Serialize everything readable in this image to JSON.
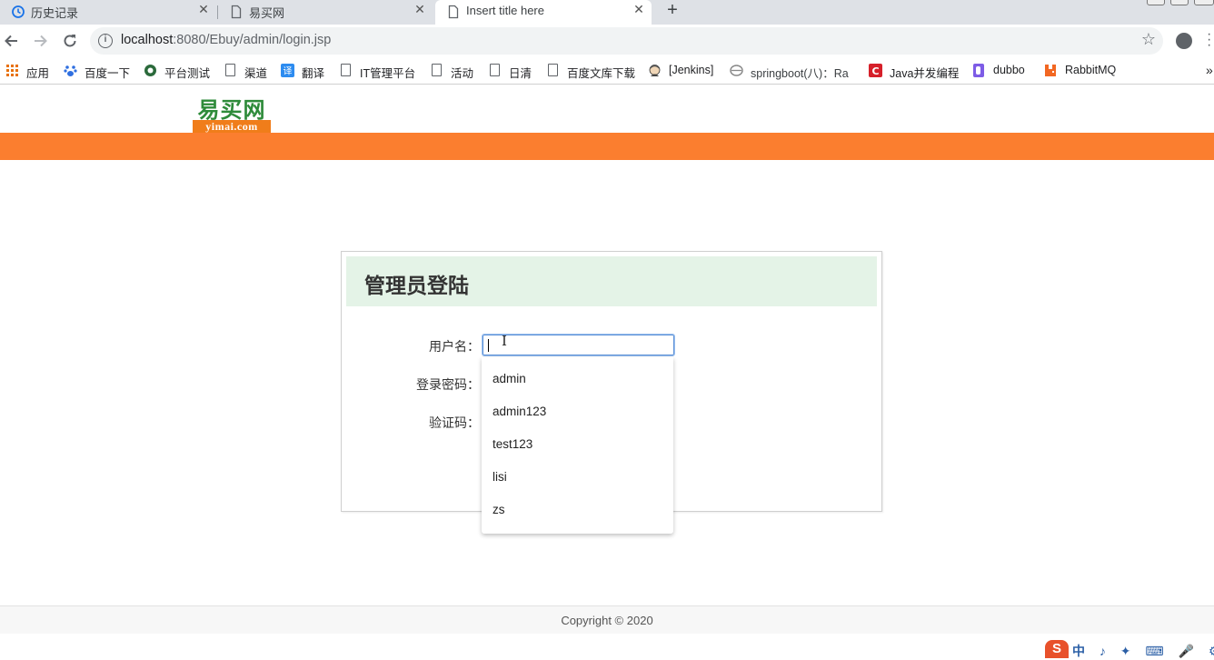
{
  "browser": {
    "tabs": [
      {
        "label": "历史记录",
        "icon": "history-icon",
        "active": false
      },
      {
        "label": "易买网",
        "icon": "page-icon",
        "active": false
      },
      {
        "label": "Insert title here",
        "icon": "page-icon",
        "active": true
      }
    ],
    "tab_close_glyph": "✕",
    "new_tab_glyph": "+",
    "url_host": "localhost",
    "url_rest": ":8080/Ebuy/admin/login.jsp",
    "info_glyph": "i",
    "star_glyph": "☆"
  },
  "bookmarks": [
    {
      "label": "应用",
      "icon": "apps-grid-icon"
    },
    {
      "label": "百度一下",
      "icon": "baidu-paw-icon"
    },
    {
      "label": "平台测试",
      "icon": "platform-globe-icon"
    },
    {
      "label": "渠道",
      "icon": "document-icon"
    },
    {
      "label": "翻译",
      "icon": "translate-icon"
    },
    {
      "label": "IT管理平台",
      "icon": "document-icon"
    },
    {
      "label": "活动",
      "icon": "document-icon"
    },
    {
      "label": "日清",
      "icon": "document-icon"
    },
    {
      "label": "百度文库下载",
      "icon": "document-icon"
    },
    {
      "label": "[Jenkins]",
      "icon": "jenkins-icon"
    },
    {
      "label": "springboot(八)：Ra",
      "icon": "springboot-icon"
    },
    {
      "label": "Java并发编程",
      "icon": "csdn-icon"
    },
    {
      "label": "dubbo",
      "icon": "dubbo-icon"
    },
    {
      "label": "RabbitMQ",
      "icon": "rabbitmq-icon"
    }
  ],
  "bookmarks_overflow": "»",
  "site": {
    "logo_cn": "易买网",
    "logo_en": "yimai.com",
    "brand_color": "#fb7e2f",
    "header_bg": "#e4f3e7"
  },
  "login": {
    "title": "管理员登陆",
    "username_label": "用户名：",
    "password_label": "登录密码：",
    "captcha_label": "验证码：",
    "username_value": ""
  },
  "autocomplete": [
    "admin",
    "admin123",
    "test123",
    "lisi",
    "zs"
  ],
  "footer": {
    "copyright": "Copyright © 2020"
  },
  "ime": {
    "logo": "S",
    "tray": "中 ♪ ✦ ⌨ 🎤 ⚙"
  }
}
